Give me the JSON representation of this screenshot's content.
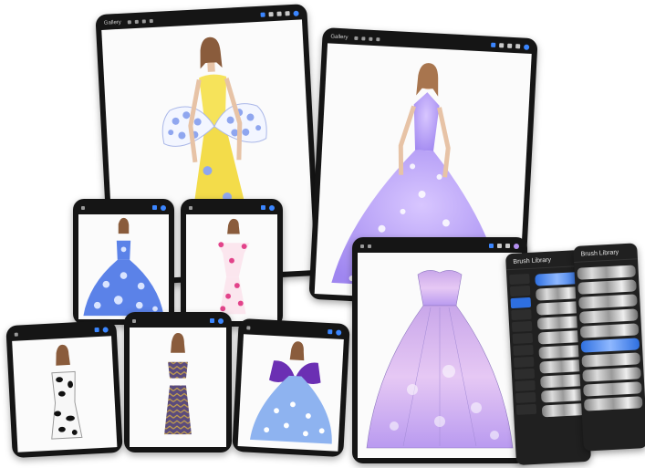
{
  "toolbar": {
    "gallery_label": "Gallery"
  },
  "panels": [
    {
      "title": "Brush Library"
    },
    {
      "title": "Brush Library"
    }
  ],
  "colors": {
    "accent": "#3b86ff",
    "device": "#151515",
    "panel": "#202020"
  },
  "icons": [
    "wrench-icon",
    "magic-wand-icon",
    "selection-icon",
    "transform-icon",
    "brush-icon",
    "smudge-icon",
    "eraser-icon",
    "layers-icon",
    "color-icon"
  ]
}
